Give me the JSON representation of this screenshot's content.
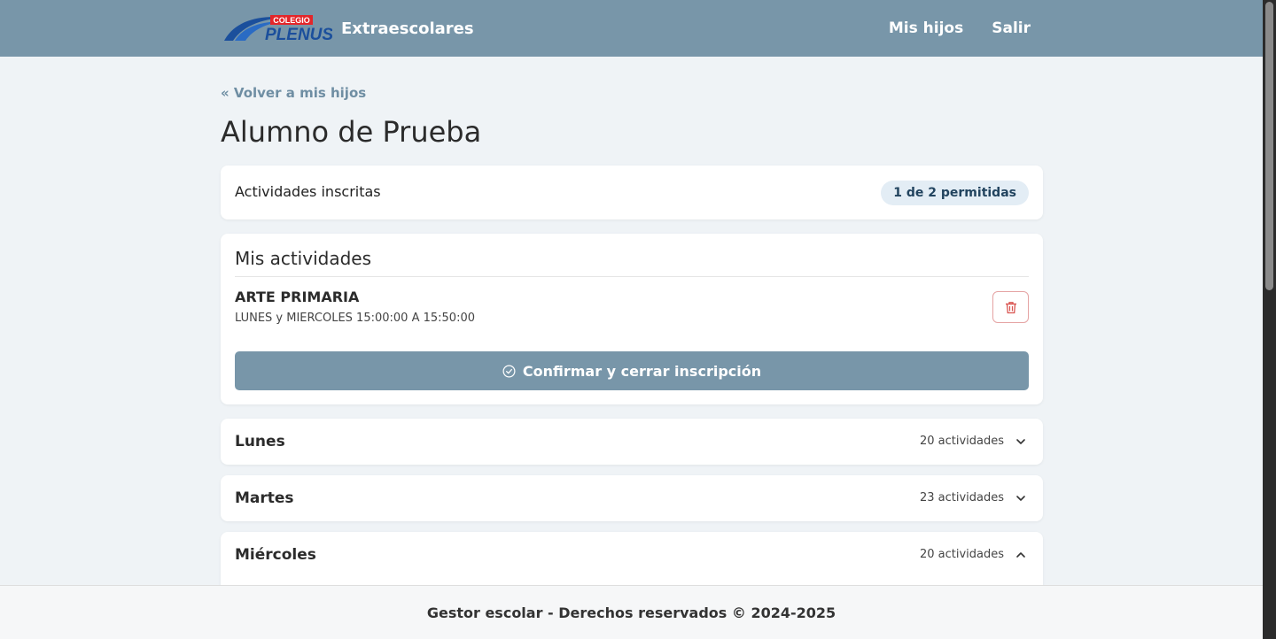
{
  "nav": {
    "logo_top_text": "COLEGIO",
    "logo_text": "PLENUS",
    "brand": "Extraescolares",
    "links": [
      "Mis hijos",
      "Salir"
    ]
  },
  "page": {
    "back_link": "« Volver a mis hijos",
    "title": "Alumno de Prueba"
  },
  "enrolled": {
    "label": "Actividades inscritas",
    "badge": "1 de 2 permitidas"
  },
  "my_activities": {
    "title": "Mis actividades",
    "items": [
      {
        "name": "ARTE PRIMARIA",
        "schedule": "LUNES y MIERCOLES 15:00:00 A 15:50:00"
      }
    ],
    "confirm_label": "Confirmar y cerrar inscripción"
  },
  "days": [
    {
      "name": "Lunes",
      "count": "20 actividades",
      "expanded": false
    },
    {
      "name": "Martes",
      "count": "23 actividades",
      "expanded": false
    },
    {
      "name": "Miércoles",
      "count": "20 actividades",
      "expanded": true
    }
  ],
  "footer": {
    "text": "Gestor escolar - Derechos reservados © 2024-2025"
  },
  "colors": {
    "navbar": "#7896a9",
    "accent": "#7896a9",
    "badge_bg": "#e3edf5",
    "delete": "#d9534f",
    "background": "#eff3f6"
  }
}
